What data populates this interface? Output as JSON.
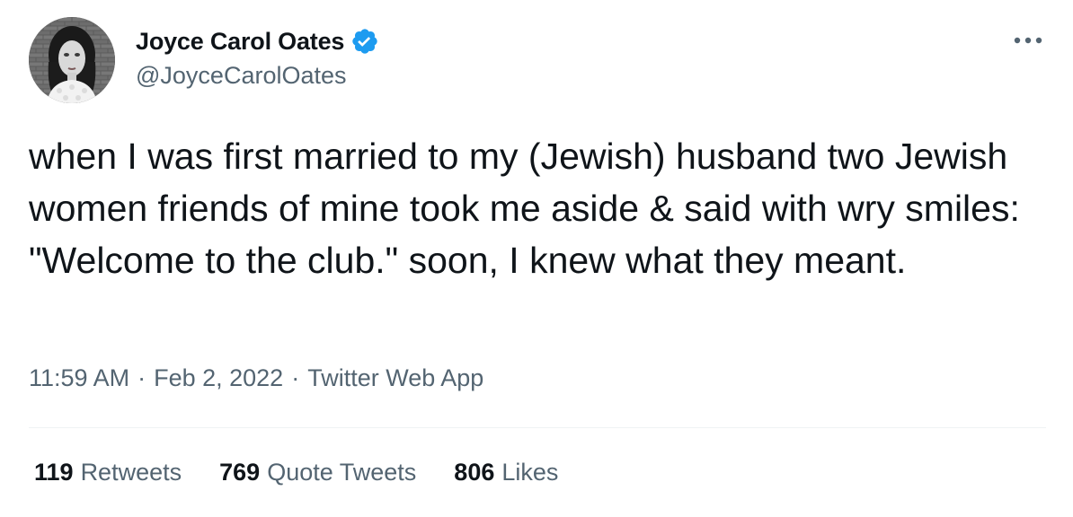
{
  "author": {
    "name": "Joyce Carol Oates",
    "handle": "@JoyceCarolOates",
    "verified": true,
    "avatar_icon": "profile-photo",
    "verified_icon": "verified-badge-icon"
  },
  "tweet": {
    "text": "when I was first married to my (Jewish) husband two Jewish women friends of mine took me aside & said with wry smiles: \"Welcome to the club.\" soon, I knew what they meant.",
    "time": "11:59 AM",
    "date": "Feb 2, 2022",
    "source": "Twitter Web App",
    "separator": "·"
  },
  "stats": [
    {
      "count": "119",
      "label": "Retweets"
    },
    {
      "count": "769",
      "label": "Quote Tweets"
    },
    {
      "count": "806",
      "label": "Likes"
    }
  ],
  "colors": {
    "primary_text": "#0f1419",
    "secondary_text": "#536471",
    "verified_blue": "#1d9bf0",
    "divider": "#eff3f4"
  },
  "icons": {
    "more": "more-horizontal-icon"
  }
}
